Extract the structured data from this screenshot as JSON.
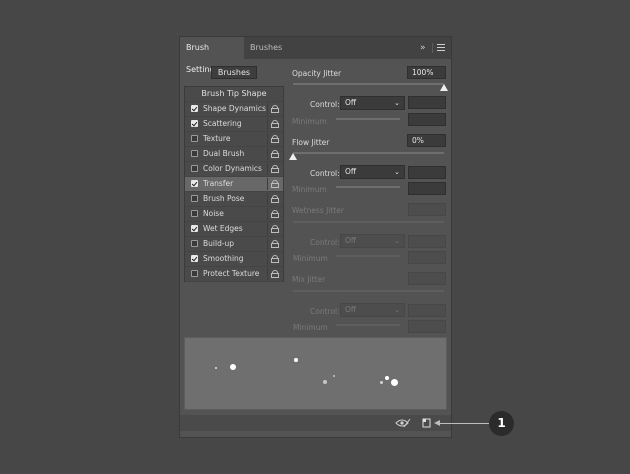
{
  "tabs": [
    {
      "label": "Brush Settings",
      "active": true
    },
    {
      "label": "Brushes",
      "active": false
    }
  ],
  "header_icons": [
    "expand-arrows-icon",
    "panel-menu-icon"
  ],
  "brushes_button": "Brushes",
  "brush_list": {
    "header": "Brush Tip Shape",
    "items": [
      {
        "label": "Shape Dynamics",
        "checked": true
      },
      {
        "label": "Scattering",
        "checked": true
      },
      {
        "label": "Texture",
        "checked": false
      },
      {
        "label": "Dual Brush",
        "checked": false
      },
      {
        "label": "Color Dynamics",
        "checked": false
      },
      {
        "label": "Transfer",
        "checked": true,
        "selected": true
      },
      {
        "label": "Brush Pose",
        "checked": false
      },
      {
        "label": "Noise",
        "checked": false
      },
      {
        "label": "Wet Edges",
        "checked": true
      },
      {
        "label": "Build-up",
        "checked": false
      },
      {
        "label": "Smoothing",
        "checked": true
      },
      {
        "label": "Protect Texture",
        "checked": false
      }
    ]
  },
  "settings": {
    "opacity_jitter": {
      "label": "Opacity Jitter",
      "value": "100%",
      "level": 1.0
    },
    "opacity_control": {
      "label": "Control:",
      "value": "Off"
    },
    "opacity_minimum": {
      "label": "Minimum"
    },
    "flow_jitter": {
      "label": "Flow Jitter",
      "value": "0%",
      "level": 0.0
    },
    "flow_control": {
      "label": "Control:",
      "value": "Off"
    },
    "flow_minimum": {
      "label": "Minimum"
    },
    "wetness_jitter": {
      "label": "Wetness Jitter"
    },
    "wetness_control": {
      "label": "Control:",
      "value": "Off"
    },
    "wetness_minimum": {
      "label": "Minimum"
    },
    "mix_jitter": {
      "label": "Mix Jitter"
    },
    "mix_control": {
      "label": "Control:",
      "value": "Off"
    },
    "mix_minimum": {
      "label": "Minimum"
    }
  },
  "bottom_icons": [
    "eye-toggle-icon",
    "new-brush-icon"
  ],
  "callout": {
    "number": "1"
  }
}
